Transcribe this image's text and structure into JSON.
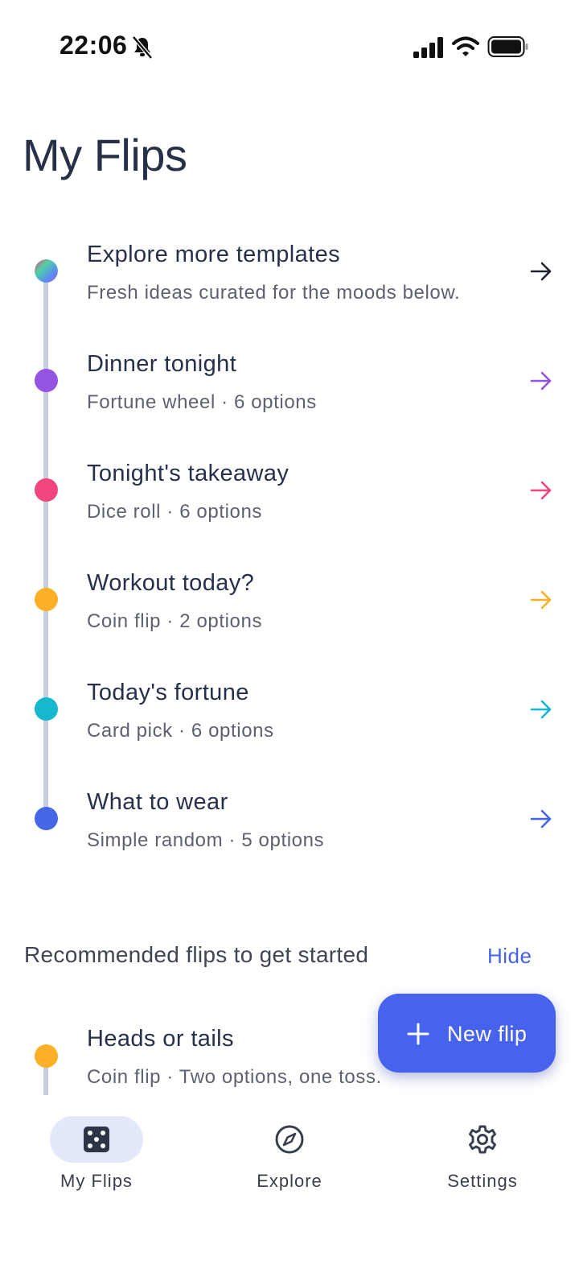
{
  "status_bar": {
    "time": "22:06"
  },
  "page_title": "My Flips",
  "flips": [
    {
      "title": "Explore more templates",
      "subtitle": "Fresh ideas curated for the moods below.",
      "color": "gradient",
      "arrow_color": "#1f232e"
    },
    {
      "title": "Dinner tonight",
      "subtitle": "Fortune wheel · 6 options",
      "color": "#9553e1",
      "arrow_color": "#9553e1"
    },
    {
      "title": "Tonight's takeaway",
      "subtitle": "Dice roll · 6 options",
      "color": "#f0467d",
      "arrow_color": "#f0467d"
    },
    {
      "title": "Workout today?",
      "subtitle": "Coin flip · 2 options",
      "color": "#fbb027",
      "arrow_color": "#fbb027"
    },
    {
      "title": "Today's fortune",
      "subtitle": "Card pick · 6 options",
      "color": "#16b8d0",
      "arrow_color": "#16b8d0"
    },
    {
      "title": "What to wear",
      "subtitle": "Simple random · 5 options",
      "color": "#4566e6",
      "arrow_color": "#4566e6"
    }
  ],
  "recommended": {
    "heading": "Recommended flips to get started",
    "hide_label": "Hide",
    "items": [
      {
        "title": "Heads or tails",
        "subtitle": "Coin flip · Two options, one toss.",
        "color": "#fbb027"
      }
    ]
  },
  "fab": {
    "label": "New flip",
    "icon": "plus-icon"
  },
  "bottom_nav": [
    {
      "label": "My Flips",
      "icon": "dice-icon",
      "active": true
    },
    {
      "label": "Explore",
      "icon": "compass-icon",
      "active": false
    },
    {
      "label": "Settings",
      "icon": "gear-icon",
      "active": false
    }
  ],
  "colors": {
    "accent": "#4762ec",
    "nav_active_bg": "#e3e8fb",
    "timeline": "#c7cedd"
  }
}
